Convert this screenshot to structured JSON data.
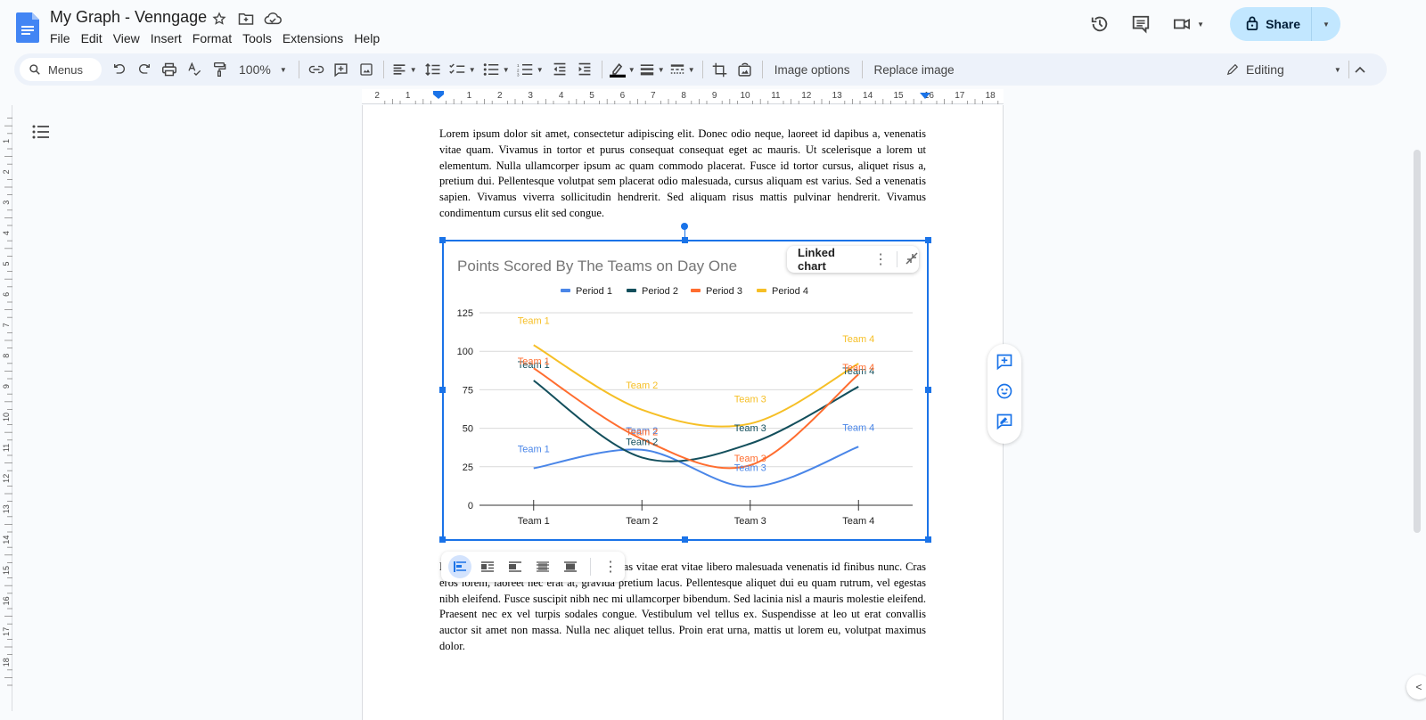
{
  "doc": {
    "title": "My Graph - Venngage",
    "menu": [
      "File",
      "Edit",
      "View",
      "Insert",
      "Format",
      "Tools",
      "Extensions",
      "Help"
    ],
    "share_label": "Share"
  },
  "toolbar": {
    "search_placeholder": "Menus",
    "zoom": "100%",
    "image_options": "Image options",
    "replace_image": "Replace image",
    "mode": "Editing"
  },
  "ruler": {
    "top_ticks": [
      "2",
      "1",
      "1",
      "2",
      "3",
      "4",
      "5",
      "6",
      "7",
      "8",
      "9",
      "10",
      "11",
      "12",
      "13",
      "14",
      "15",
      "16",
      "17",
      "18"
    ],
    "left_ticks": [
      "1",
      "2",
      "3",
      "4",
      "5",
      "6",
      "7",
      "8",
      "9",
      "10",
      "11",
      "12",
      "13",
      "14",
      "15",
      "16",
      "17",
      "18"
    ]
  },
  "body": {
    "para1": "Lorem ipsum dolor sit amet, consectetur adipiscing elit. Donec odio neque, laoreet id dapibus a, venenatis vitae quam. Vivamus in tortor et purus consequat consequat eget ac mauris. Ut scelerisque a lorem ut elementum. Nulla ullamcorper ipsum ac quam commodo placerat. Fusce id tortor cursus, aliquet risus a, pretium dui. Pellentesque volutpat sem placerat odio malesuada, cursus aliquam est varius. Sed a venenatis sapien. Vivamus viverra sollicitudin hendrerit. Sed aliquam risus mattis pulvinar hendrerit. Vivamus condimentum cursus elit sed congue.",
    "para2": "Integer non lacus tincidunt quis. Maecenas vitae erat vitae libero malesuada venenatis id finibus nunc. Cras eros lorem, laoreet nec erat at, gravida pretium lacus. Pellentesque aliquet dui eu quam rutrum, vel egestas nibh eleifend. Fusce suscipit nibh nec mi ullamcorper bibendum. Sed lacinia nisl a mauris molestie eleifend. Praesent nec ex vel turpis sodales congue. Vestibulum vel tellus ex. Suspendisse at leo ut erat convallis auctor sit amet non massa. Nulla nec aliquet tellus. Proin erat urna, mattis ut lorem eu, volutpat maximus dolor."
  },
  "linked_chart_label": "Linked chart",
  "chart_data": {
    "type": "line",
    "title": "Points Scored By The Teams on Day One",
    "xlabel": "",
    "ylabel": "",
    "categories": [
      "Team 1",
      "Team 2",
      "Team 3",
      "Team 4"
    ],
    "ylim": [
      0,
      125
    ],
    "yticks": [
      0,
      25,
      50,
      75,
      100,
      125
    ],
    "grid": true,
    "legend": "top",
    "smooth": true,
    "point_labels": true,
    "series": [
      {
        "name": "Period 1",
        "color": "#4a86e8",
        "values": [
          24,
          36,
          12,
          38
        ]
      },
      {
        "name": "Period 2",
        "color": "#134f5c",
        "values": [
          81,
          31,
          40,
          77
        ]
      },
      {
        "name": "Period 3",
        "color": "#ff6d2f",
        "values": [
          89,
          43,
          26,
          85
        ]
      },
      {
        "name": "Period 4",
        "color": "#f6bf26",
        "values": [
          104,
          62,
          53,
          92
        ]
      }
    ]
  }
}
